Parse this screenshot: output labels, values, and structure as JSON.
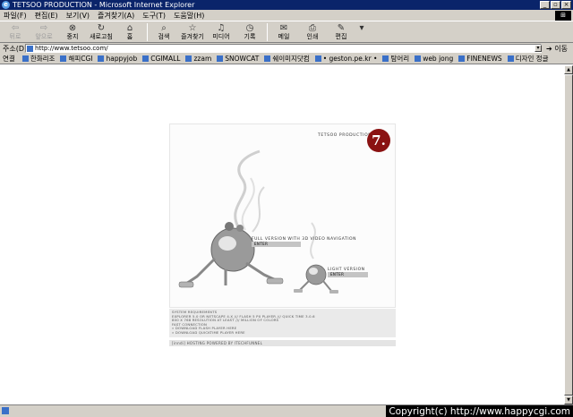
{
  "window": {
    "title": "TETSOO PRODUCTION - Microsoft Internet Explorer",
    "buttons": [
      "_",
      "▫",
      "×"
    ]
  },
  "menu": {
    "items": [
      "파일(F)",
      "편집(E)",
      "보기(V)",
      "즐겨찾기(A)",
      "도구(T)",
      "도움말(H)"
    ]
  },
  "toolbar": {
    "back": "뒤로",
    "forward": "앞으로",
    "stop": "중지",
    "refresh": "새로고침",
    "home": "홈",
    "search": "검색",
    "favorites": "즐겨찾기",
    "media": "미디어",
    "history": "기록",
    "mail": "메일",
    "print": "인쇄",
    "edit": "편집"
  },
  "address": {
    "label": "주소(D)",
    "url": "http://www.tetsoo.com/",
    "go": "이동"
  },
  "links": {
    "label": "연결",
    "items": [
      "한화리조",
      "해피CGI",
      "happyjob",
      "CGIMALL",
      "zzam",
      "SNOWCAT",
      "쉐이미지닷컴",
      "• geston.pe.kr •",
      "탐어리",
      "web jong",
      "FINENEWS",
      "디자인 정글"
    ]
  },
  "site": {
    "brand": "TETSOO PRODUCTION",
    "logo_letter": "7.",
    "full_version": "FULL VERSION WITH 3D VIDEO NAVIGATION",
    "full_enter": "ENTER",
    "light_version": "LIGHT VERSION",
    "light_enter": "ENTER",
    "sysreq": [
      "SYSTEM REQUIREMENTS",
      "EXPLORER 5.0 OR NETSCAPE 4.X /// FLASH 5 PX PLAYER /// QUICK TIME 3.0.6",
      "800 X 768 RESOLUTION AT LEAST /// MILLION OF COLORS",
      "FAST CONNECTION",
      "» DOWNLOAD FLASH PLAYER HERE",
      "» DOWNLOAD QUICKTIME PLAYER HERE"
    ],
    "hosting": "[inndi] HOSTING POWERED BY ITECHFUNNEL"
  },
  "status": {
    "copyright": "Copyright(c) http://www.happycgi.com"
  },
  "colors": {
    "titlebar": "#0a246a",
    "chrome": "#d4d0c8",
    "logo": "#8a1212"
  }
}
